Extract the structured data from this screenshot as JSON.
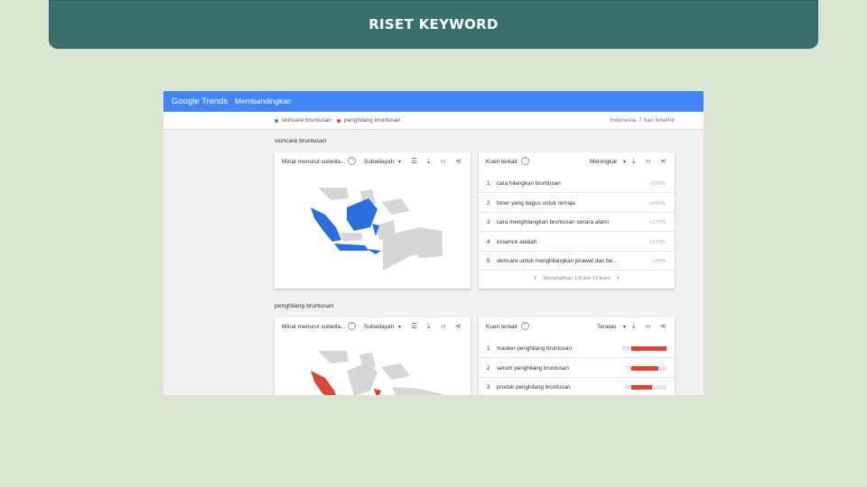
{
  "banner": {
    "title": "RISET KEYWORD"
  },
  "trends": {
    "logo": {
      "google": "Google",
      "trends": "Trends"
    },
    "nav_title": "Membandingkan",
    "terms": [
      {
        "label": "skincare bruntusan",
        "color": "#4285f4"
      },
      {
        "label": "penghilang bruntusan",
        "color": "#db4437"
      }
    ],
    "region_time": "Indonesia, 7 hari terakhir",
    "sections": [
      {
        "title": "skincare bruntusan",
        "map_card": {
          "title": "Minat menurut subwila...",
          "selector": "Subwilayah",
          "map_color": "#2a6fdb"
        },
        "queries_card": {
          "title": "Kueri terkait",
          "selector": "Meningkat",
          "rows": [
            {
              "rank": "1",
              "query": "cara hilangkan bruntusan",
              "value": "+250%"
            },
            {
              "rank": "2",
              "query": "toner yang bagus untuk remaja",
              "value": "+250%"
            },
            {
              "rank": "3",
              "query": "cara menghilangkan bruntusan secara alami",
              "value": "+170%"
            },
            {
              "rank": "4",
              "query": "essence adalah",
              "value": "+170%"
            },
            {
              "rank": "5",
              "query": "skincare untuk menghilangkan jerawat dan be...",
              "value": "+90%"
            }
          ],
          "pager_text": "Menampilkan 1-5 dari 13 kueri"
        }
      },
      {
        "title": "penghilang bruntusan",
        "map_card": {
          "title": "Minat menurut subwila...",
          "selector": "Subwilayah",
          "map_color": "#db4437"
        },
        "queries_card": {
          "title": "Kueri terkait",
          "selector": "Teratas",
          "rows": [
            {
              "rank": "1",
              "query": "masker penghilang bruntusan",
              "value": "100",
              "level": 100
            },
            {
              "rank": "2",
              "query": "serum penghilang bruntusan",
              "value": "76",
              "level": 76
            },
            {
              "rank": "3",
              "query": "produk penghilang bruntusan",
              "value": "59",
              "level": 59
            }
          ]
        }
      }
    ],
    "icons": [
      "help-icon",
      "list-icon",
      "download-icon",
      "embed-icon",
      "share-icon",
      "chevron-left-icon",
      "chevron-right-icon"
    ]
  }
}
